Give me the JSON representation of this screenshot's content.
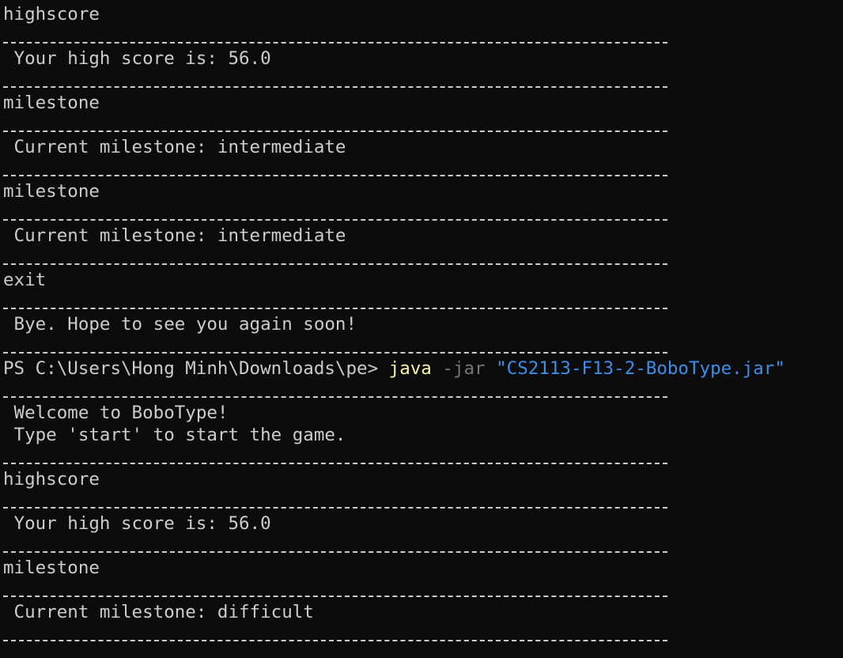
{
  "terminal": {
    "lines": [
      "highscore",
      "",
      " Your high score is: 56.0",
      "",
      "milestone",
      "",
      " Current milestone: intermediate",
      "",
      "milestone",
      "",
      " Current milestone: intermediate",
      "",
      "exit",
      "",
      " Bye. Hope to see you again soon!",
      "",
      "",
      "",
      " Welcome to BoboType!",
      " Type 'start' to start the game.",
      "",
      "highscore",
      "",
      " Your high score is: 56.0",
      "",
      "milestone",
      "",
      " Current milestone: difficult",
      ""
    ],
    "prompt": {
      "path": "PS C:\\Users\\Hong Minh\\Downloads\\pe> ",
      "command": "java",
      "flag": "-jar",
      "argument": "\"CS2113-F13-2-BoboType.jar\""
    },
    "colors": {
      "background": "#0c0c0c",
      "text": "#cccccc",
      "command": "#f9f1a5",
      "flag": "#767676",
      "string": "#3b8eea"
    }
  }
}
